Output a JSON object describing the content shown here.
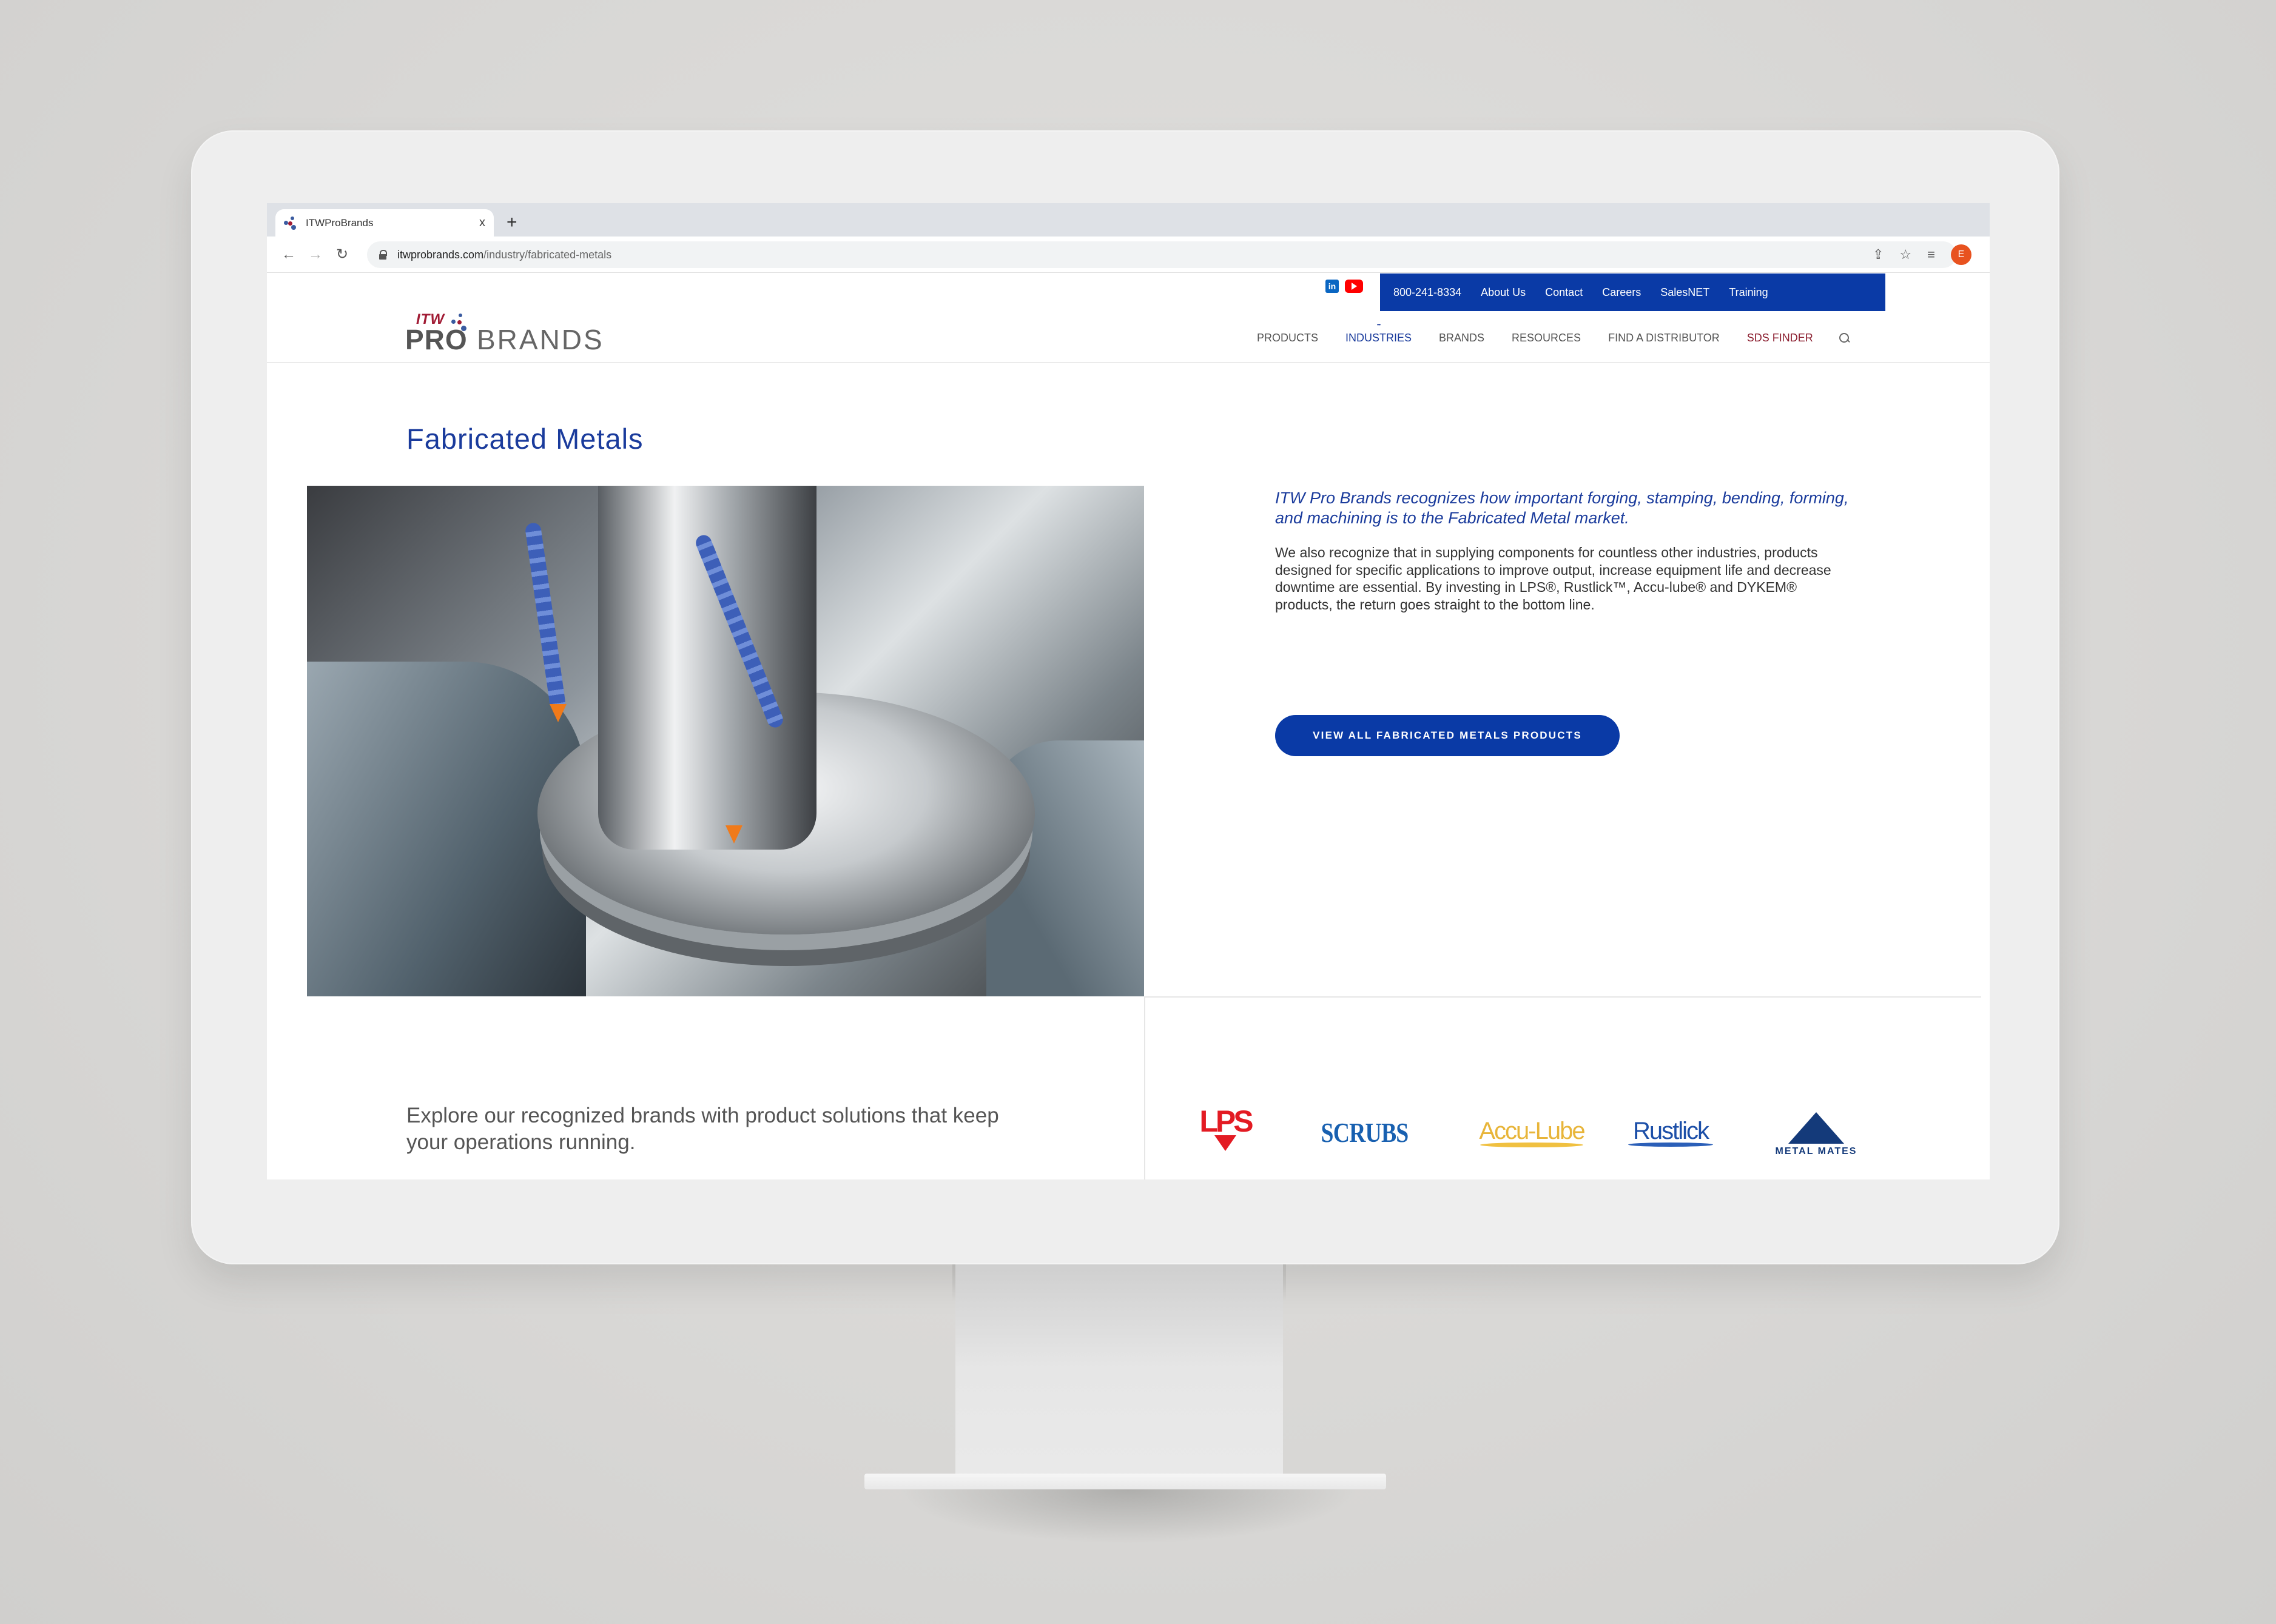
{
  "browser": {
    "tab_title": "ITWProBrands",
    "tab_close": "x",
    "new_tab": "+",
    "url_host": "itwprobrands.com",
    "url_path": "/industry/fabricated-metals",
    "back": "←",
    "forward": "→",
    "reload": "↻",
    "share": "⇪",
    "bookmark": "☆",
    "reading_list": "≡",
    "profile_initial": "E",
    "profile_color": "#e8521f"
  },
  "site": {
    "logo": {
      "itw": "ITW",
      "pro": "PRO",
      "brands": "BRANDS"
    },
    "social": {
      "linkedin": "in"
    },
    "utility_nav": [
      "800-241-8334",
      "About Us",
      "Contact",
      "Careers",
      "SalesNET",
      "Training"
    ],
    "main_nav": [
      {
        "label": "PRODUCTS",
        "state": "default"
      },
      {
        "label": "INDUSTRIES",
        "state": "active"
      },
      {
        "label": "BRANDS",
        "state": "default"
      },
      {
        "label": "RESOURCES",
        "state": "default"
      },
      {
        "label": "FIND A DISTRIBUTOR",
        "state": "default"
      },
      {
        "label": "SDS FINDER",
        "state": "highlight"
      }
    ],
    "colors": {
      "brand_blue": "#0a3aa6",
      "title_blue": "#1a3b9c",
      "sds_red": "#8b1e2f",
      "itw_red": "#a11c35"
    }
  },
  "content": {
    "title": "Fabricated Metals",
    "intro": "ITW Pro Brands recognizes how important forging, stamping, bending, forming, and machining is to the Fabricated Metal market.",
    "body": "We also recognize that in supplying components for countless other industries, products designed for specific applications to improve output, increase equipment life and decrease downtime are essential. By investing in LPS®, Rustlick™, Accu-lube® and DYKEM® products, the return goes straight to the bottom line.",
    "cta": "VIEW ALL FABRICATED METALS PRODUCTS",
    "image_alt": "CNC machine milling a bevel gear",
    "explore": "Explore our recognized brands with product solutions that keep your operations running."
  },
  "brands": [
    {
      "name": "LPS",
      "mark": "LPS"
    },
    {
      "name": "SCRUBS",
      "mark": "SCRUBS"
    },
    {
      "name": "Accu-Lube",
      "mark": "Accu-Lube"
    },
    {
      "name": "Rustlick",
      "mark": "Rustlick"
    },
    {
      "name": "Metal Mates",
      "mark": "METAL MATES"
    }
  ]
}
